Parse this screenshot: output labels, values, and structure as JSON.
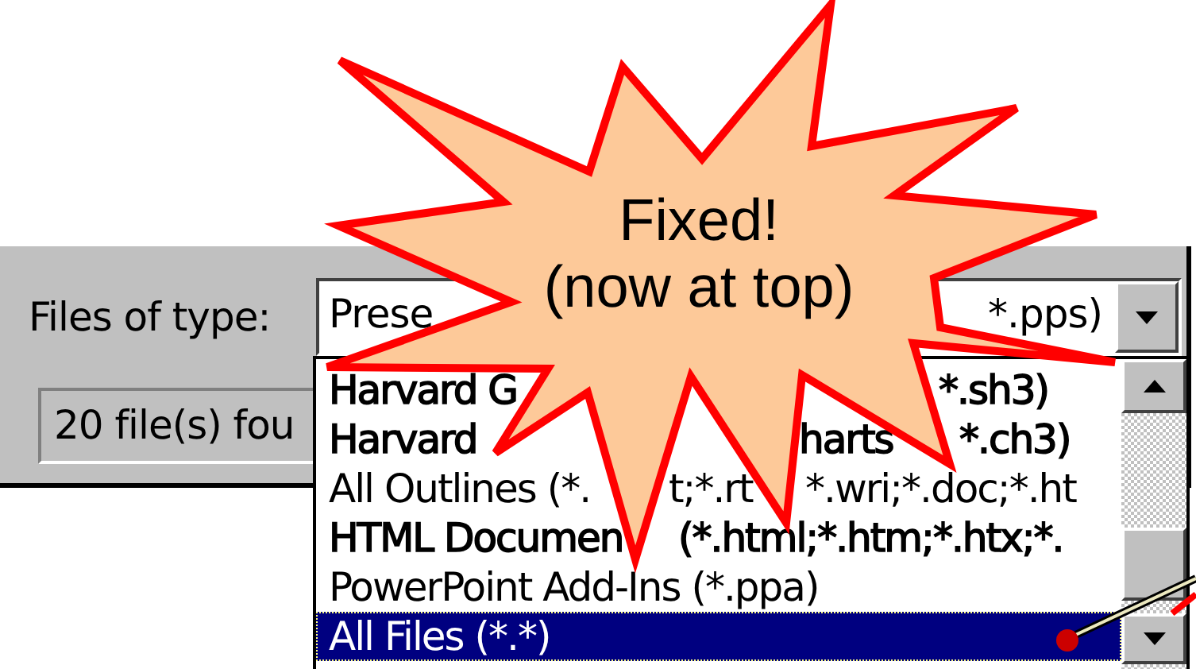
{
  "dialog": {
    "file_type_label": "Files of type:",
    "file_type_value": [
      "Prese",
      "*.pps)"
    ],
    "status": "20 file(s) fou"
  },
  "dropdown": {
    "items": [
      {
        "parts": [
          "Harvard G",
          "*.sh3)"
        ],
        "bold": true,
        "selected": false
      },
      {
        "parts": [
          "Harvard",
          "harts",
          "*.ch3)"
        ],
        "bold": true,
        "selected": false
      },
      {
        "parts": [
          "All Outlines (*.",
          "t;*.rt",
          "*.wri;*.doc;*.ht"
        ],
        "bold": false,
        "selected": false
      },
      {
        "parts": [
          "HTML Documen",
          "(*.html;*.htm;*.htx;*."
        ],
        "bold": true,
        "selected": false
      },
      {
        "parts": [
          "PowerPoint Add-Ins (*.ppa)"
        ],
        "bold": false,
        "selected": false
      },
      {
        "parts": [
          "All Files (*.*)"
        ],
        "bold": false,
        "selected": true
      }
    ]
  },
  "callout": {
    "lines": [
      "Fixed!",
      "(now at top)"
    ]
  }
}
